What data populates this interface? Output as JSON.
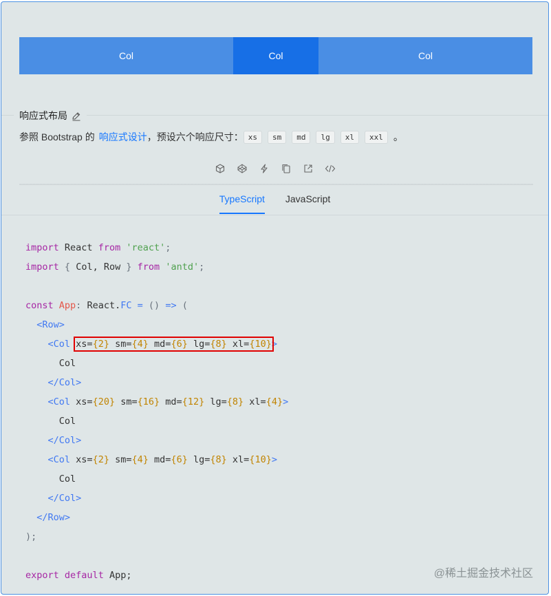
{
  "demo": {
    "cols": [
      "Col",
      "Col",
      "Col"
    ],
    "colors": [
      "#4a8ee4",
      "#176fe6",
      "#4a8ee4"
    ]
  },
  "section": {
    "title": "响应式布局",
    "desc_prefix": "参照 Bootstrap 的",
    "desc_link": "响应式设计",
    "desc_mid": "，预设六个响应尺寸：",
    "sizes": [
      "xs",
      "sm",
      "md",
      "lg",
      "xl",
      "xxl"
    ],
    "desc_end": "。"
  },
  "toolbar": {
    "icons": [
      "codesandbox-icon",
      "codepen-icon",
      "stackblitz-icon",
      "copy-icon",
      "open-external-icon",
      "code-icon"
    ]
  },
  "tabs": [
    {
      "label": "TypeScript",
      "active": true
    },
    {
      "label": "JavaScript",
      "active": false
    }
  ],
  "code": {
    "l1": {
      "import": "import",
      "react": "React",
      "from": "from",
      "mod": "'react'",
      "end": ";"
    },
    "l2": {
      "import": "import",
      "open": "{",
      "col": "Col,",
      "row": "Row",
      "close": "}",
      "from": "from",
      "mod": "'antd'",
      "end": ";"
    },
    "l4": {
      "const": "const",
      "app": "App",
      "colon": ":",
      "type": "React.",
      "fc": "FC",
      "eq": "=",
      "args": "()",
      "arrow": "=>",
      "paren": "("
    },
    "row_open": "<Row>",
    "col_open": "<Col",
    "col_text": "Col",
    "col_close": "</Col>",
    "row_close": "</Row>",
    "close_paren": ");",
    "export": {
      "export": "export",
      "default": "default",
      "app": "App;"
    },
    "props1": {
      "xs": "2",
      "sm": "4",
      "md": "6",
      "lg": "8",
      "xl": "10"
    },
    "props2": {
      "xs": "20",
      "sm": "16",
      "md": "12",
      "lg": "8",
      "xl": "4"
    },
    "props3": {
      "xs": "2",
      "sm": "4",
      "md": "6",
      "lg": "8",
      "xl": "10"
    },
    "gt": ">"
  },
  "watermark": "@稀土掘金技术社区"
}
